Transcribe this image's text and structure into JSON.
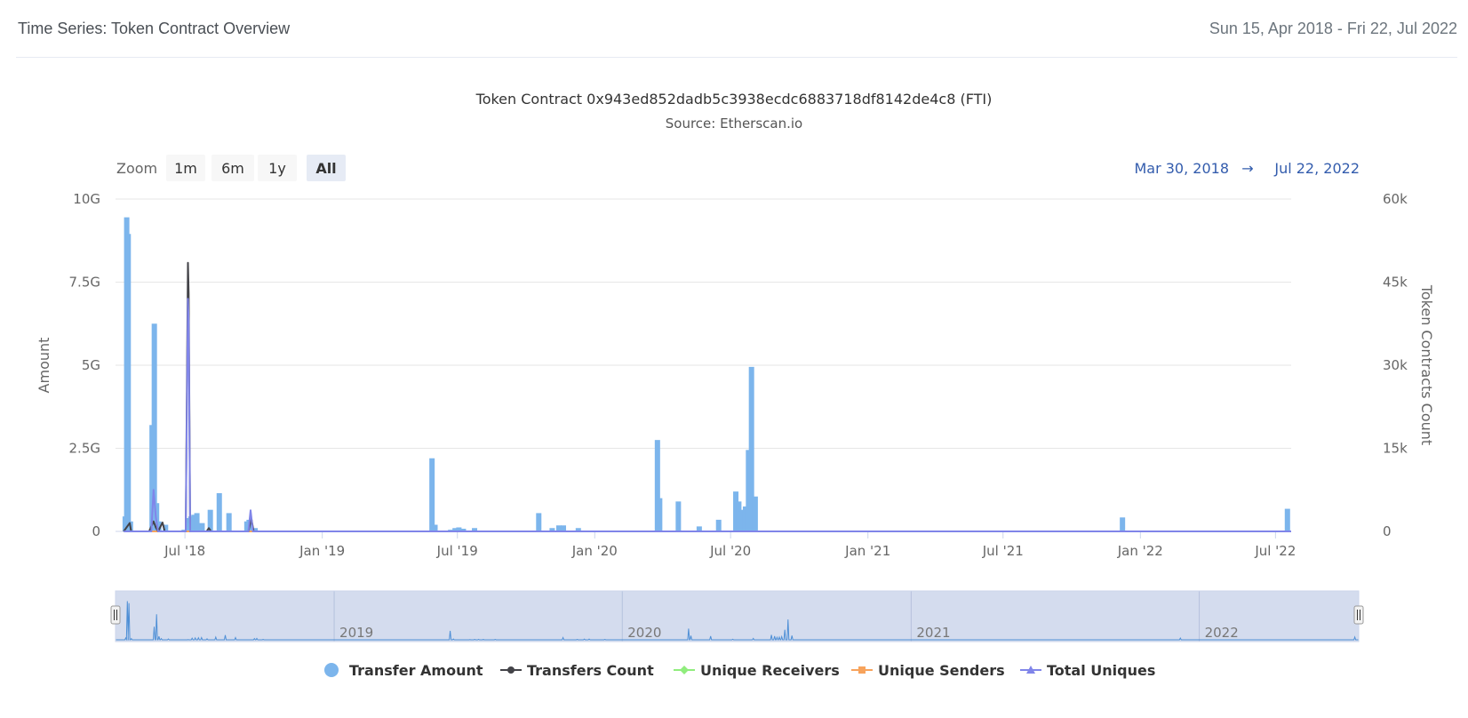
{
  "header": {
    "title": "Time Series: Token Contract Overview",
    "date_range": "Sun 15, Apr 2018 - Fri 22, Jul 2022"
  },
  "range_selector": {
    "zoom_label": "Zoom",
    "buttons": [
      "1m",
      "6m",
      "1y",
      "All"
    ],
    "selected": "All",
    "from": "Mar 30, 2018",
    "arrow": "→",
    "to": "Jul 22, 2022"
  },
  "colors": {
    "transfer_amount": "#7cb5ec",
    "transfers_count": "#434348",
    "unique_receivers": "#90ed7d",
    "unique_senders": "#f7a35c",
    "total_uniques": "#8085e9",
    "navigator_fill": "#ccd6eb"
  },
  "chart_data": {
    "type": "bar",
    "title": "Token Contract 0x943ed852dadb5c3938ecdc6883718df8142de4c8 (FTI)",
    "subtitle": "Source: Etherscan.io",
    "ylabel": "Amount",
    "y2label": "Token Contracts Count",
    "ylim": [
      0,
      10000000000
    ],
    "y2lim": [
      0,
      60000
    ],
    "y_ticks": [
      "0",
      "2.5G",
      "5G",
      "7.5G",
      "10G"
    ],
    "y2_ticks": [
      "0",
      "15k",
      "30k",
      "45k",
      "60k"
    ],
    "xlim": [
      "2018-03-30",
      "2022-07-22"
    ],
    "x_ticks": [
      {
        "date": "2018-07-01",
        "label": "Jul '18"
      },
      {
        "date": "2019-01-01",
        "label": "Jan '19"
      },
      {
        "date": "2019-07-01",
        "label": "Jul '19"
      },
      {
        "date": "2020-01-01",
        "label": "Jan '20"
      },
      {
        "date": "2020-07-01",
        "label": "Jul '20"
      },
      {
        "date": "2021-01-01",
        "label": "Jan '21"
      },
      {
        "date": "2021-07-01",
        "label": "Jul '21"
      },
      {
        "date": "2022-01-01",
        "label": "Jan '22"
      },
      {
        "date": "2022-07-01",
        "label": "Jul '22"
      }
    ],
    "navigator_ticks": [
      {
        "date": "2019-01-01",
        "label": "2019"
      },
      {
        "date": "2020-01-01",
        "label": "2020"
      },
      {
        "date": "2021-01-01",
        "label": "2021"
      },
      {
        "date": "2022-01-01",
        "label": "2022"
      }
    ],
    "legend": [
      "Transfer Amount",
      "Transfers Count",
      "Unique Receivers",
      "Unique Senders",
      "Total Uniques"
    ],
    "legend_position": "bottom",
    "grid": true,
    "series": [
      {
        "name": "Transfer Amount",
        "type": "column",
        "axis": "left",
        "points": [
          [
            "2018-04-12",
            0.45
          ],
          [
            "2018-04-14",
            9.45
          ],
          [
            "2018-04-16",
            8.95
          ],
          [
            "2018-04-19",
            0.3
          ],
          [
            "2018-05-18",
            3.2
          ],
          [
            "2018-05-21",
            6.25
          ],
          [
            "2018-05-24",
            0.85
          ],
          [
            "2018-05-27",
            0.3
          ],
          [
            "2018-06-05",
            0.2
          ],
          [
            "2018-06-30",
            0.05
          ],
          [
            "2018-07-05",
            0.4
          ],
          [
            "2018-07-09",
            0.45
          ],
          [
            "2018-07-13",
            0.5
          ],
          [
            "2018-07-17",
            0.55
          ],
          [
            "2018-07-24",
            0.25
          ],
          [
            "2018-08-04",
            0.65
          ],
          [
            "2018-08-16",
            1.15
          ],
          [
            "2018-08-29",
            0.55
          ],
          [
            "2018-09-22",
            0.3
          ],
          [
            "2018-09-25",
            0.35
          ],
          [
            "2018-10-03",
            0.1
          ],
          [
            "2019-05-28",
            2.2
          ],
          [
            "2019-06-01",
            0.2
          ],
          [
            "2019-06-22",
            0.05
          ],
          [
            "2019-06-28",
            0.1
          ],
          [
            "2019-07-03",
            0.12
          ],
          [
            "2019-07-09",
            0.08
          ],
          [
            "2019-07-24",
            0.1
          ],
          [
            "2019-10-18",
            0.55
          ],
          [
            "2019-11-05",
            0.1
          ],
          [
            "2019-11-14",
            0.18
          ],
          [
            "2019-11-20",
            0.18
          ],
          [
            "2019-12-10",
            0.1
          ],
          [
            "2020-03-25",
            2.75
          ],
          [
            "2020-03-28",
            1.0
          ],
          [
            "2020-04-22",
            0.9
          ],
          [
            "2020-05-20",
            0.15
          ],
          [
            "2020-06-15",
            0.35
          ],
          [
            "2020-07-08",
            1.2
          ],
          [
            "2020-07-12",
            0.9
          ],
          [
            "2020-07-15",
            0.6
          ],
          [
            "2020-07-18",
            0.65
          ],
          [
            "2020-07-21",
            0.75
          ],
          [
            "2020-07-25",
            2.45
          ],
          [
            "2020-07-29",
            4.95
          ],
          [
            "2020-08-03",
            1.05
          ],
          [
            "2021-12-08",
            0.42
          ],
          [
            "2022-07-17",
            0.68
          ]
        ]
      },
      {
        "name": "Transfers Count",
        "type": "line",
        "axis": "right",
        "points": [
          [
            "2018-04-10",
            0
          ],
          [
            "2018-04-18",
            1500
          ],
          [
            "2018-04-20",
            0
          ],
          [
            "2018-05-14",
            0
          ],
          [
            "2018-05-20",
            1800
          ],
          [
            "2018-05-23",
            700
          ],
          [
            "2018-05-26",
            0
          ],
          [
            "2018-06-01",
            1600
          ],
          [
            "2018-06-04",
            0
          ],
          [
            "2018-07-02",
            0
          ],
          [
            "2018-07-05",
            48500
          ],
          [
            "2018-07-06",
            43000
          ],
          [
            "2018-07-08",
            0
          ],
          [
            "2018-07-30",
            0
          ],
          [
            "2018-08-02",
            600
          ],
          [
            "2018-08-05",
            0
          ],
          [
            "2018-09-24",
            0
          ],
          [
            "2018-09-28",
            2300
          ],
          [
            "2018-10-01",
            0
          ],
          [
            "2022-07-22",
            0
          ]
        ]
      },
      {
        "name": "Unique Receivers",
        "type": "line",
        "axis": "right",
        "points": [
          [
            "2018-04-10",
            0
          ],
          [
            "2022-07-22",
            0
          ]
        ]
      },
      {
        "name": "Unique Senders",
        "type": "line",
        "axis": "right",
        "points": [
          [
            "2018-04-10",
            0
          ],
          [
            "2022-07-22",
            0
          ]
        ]
      },
      {
        "name": "Total Uniques",
        "type": "line",
        "axis": "right",
        "points": [
          [
            "2018-04-10",
            0
          ],
          [
            "2018-05-17",
            0
          ],
          [
            "2018-05-20",
            7500
          ],
          [
            "2018-05-23",
            2500
          ],
          [
            "2018-05-26",
            0
          ],
          [
            "2018-07-02",
            0
          ],
          [
            "2018-07-05",
            42000
          ],
          [
            "2018-07-06",
            38000
          ],
          [
            "2018-07-08",
            0
          ],
          [
            "2018-09-24",
            0
          ],
          [
            "2018-09-27",
            3800
          ],
          [
            "2018-09-30",
            0
          ],
          [
            "2022-07-22",
            0
          ]
        ]
      }
    ]
  }
}
